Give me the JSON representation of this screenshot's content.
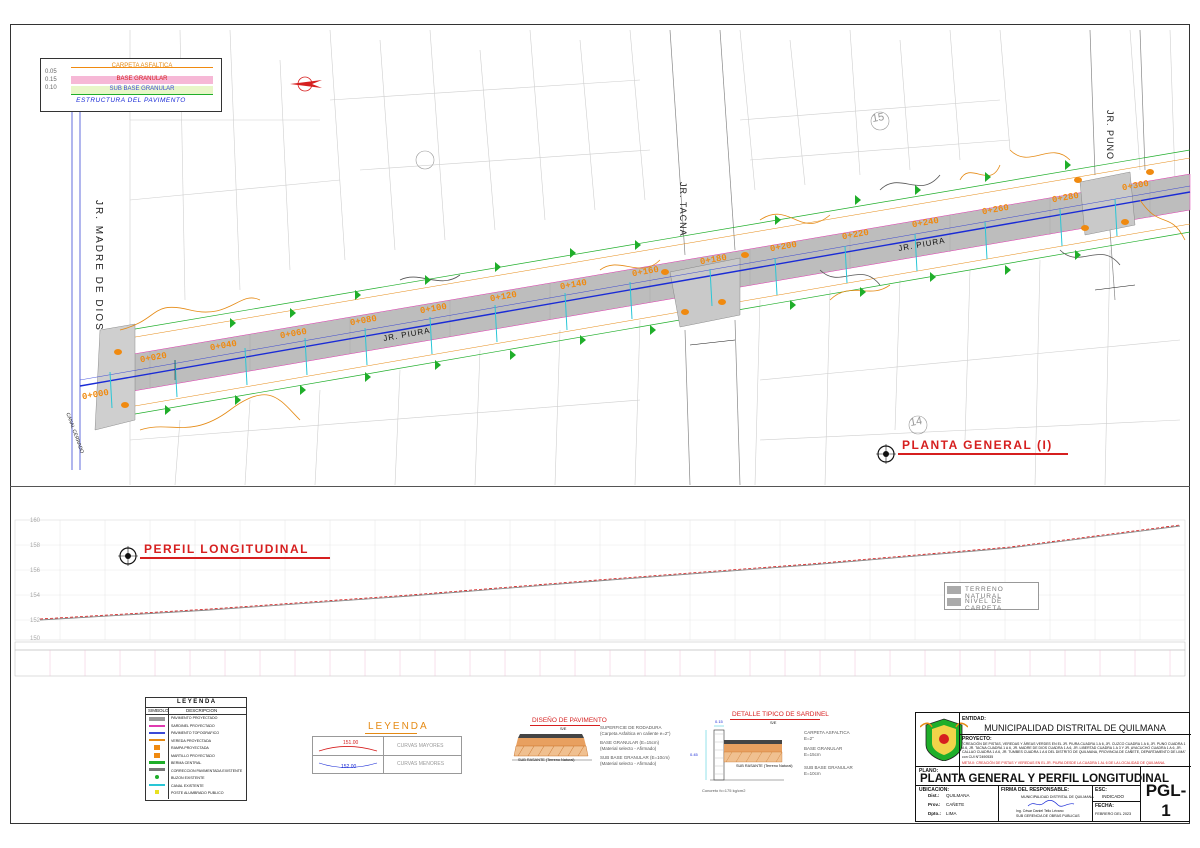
{
  "pavement_box": {
    "layers": [
      "CARPETA ASFALTICA",
      "BASE GRANULAR",
      "SUB BASE GRANULAR"
    ],
    "thicknesses": [
      "0.05",
      "0.15",
      "0.10"
    ],
    "caption": "ESTRUCTURA DEL PAVIMENTO"
  },
  "streets": {
    "madre": "JR. MADRE DE DIOS",
    "tacna": "JR. TACNA",
    "puno": "JR. PUNO",
    "piura_1": "JR. PIURA",
    "piura_2": "JR. PIURA",
    "piura_3": "JR. PIURA",
    "canal": "CANAL CERRADO"
  },
  "plan": {
    "stations": [
      "0+000",
      "0+020",
      "0+040",
      "0+060",
      "0+080",
      "0+100",
      "0+120",
      "0+140",
      "0+160",
      "0+180",
      "0+200",
      "0+220",
      "0+240",
      "0+260",
      "0+280",
      "0+300"
    ],
    "lot_labels": [
      "15",
      "14"
    ],
    "title": "PLANTA GENERAL (I)"
  },
  "profile": {
    "title": "PERFIL LONGITUDINAL",
    "legend": [
      "TERRENO NATURAL",
      "NIVEL DE CARPETA"
    ],
    "elev_labels": [
      "160",
      "158",
      "156",
      "154",
      "152",
      "150"
    ]
  },
  "legend_table": {
    "title": "L E Y E N D A",
    "col1": "SIMBOLO",
    "col2": "DESCRIPCION",
    "rows": [
      "PAVIMENTO PROYECTADO",
      "SARDINEL PROYECTADO",
      "PAVIMENTO TOPOGRAFICO",
      "VEREDA PROYECTADA",
      "RAMPA PROYECTADA",
      "MARTILLO PROYECTADO",
      "BERMA CENTRAL",
      "CORRECCION PAVIMENTADA EXISTENTE",
      "BUZON EXISTENTE",
      "CANAL EXISTENTE",
      "POSTE ALUMBRADO PUBLICO"
    ]
  },
  "leyenda_curves": {
    "title": "LEYENDA",
    "major": "CURVAS MAYORES",
    "minor": "CURVAS MENORES",
    "major_val": "151.00",
    "minor_val": "152.00"
  },
  "diseno": {
    "title": "DISEÑO DE PAVIMENTO",
    "scale": "S/E",
    "items": [
      "SUPERFICIE DE RODADURA",
      "(Carpeta Asfaltica en caliente e=2\")",
      "BASE GRANULAR (E=15cm)",
      "(Material selecto - Afirmado)",
      "SUB BASE GRANULAR (E=10cm)",
      "(Material selecto - Afirmado)"
    ],
    "ground": "SUB RASANTE (Terreno Natural)"
  },
  "sardinel": {
    "title": "DETALLE TIPICO DE SARDINEL",
    "scale": "S/E",
    "items": [
      "CARPETA ASFALTICA",
      "E=2\"",
      "BASE GRANULAR",
      "E=15cm",
      "SUB BASE GRANULAR",
      "E=10cm"
    ],
    "concrete": "Concreto fc=175 kg/cm2",
    "ground": "SUB RASANTE (Terreno Natural)",
    "dims": [
      "0.15",
      "0.45"
    ]
  },
  "title_block": {
    "entidad_lbl": "ENTIDAD:",
    "entidad": "MUNICIPALIDAD DISTRITAL DE QUILMANA",
    "proyecto_lbl": "PROYECTO:",
    "proyecto": "\"CREACIÓN DE PISTAS, VEREDAS Y ÁREAS VERDES EN EL JR. PIURA CUADRA 1 A 6, JR. CUZCO CUADRA 1 A 6, JR. PUNO CUADRA 1 A 6, JR. TACNA CUADRA 1 A 6, JR. MADRE DE DIOS CUADRA 1 A 6, JR. LIBERTAD CUADRA 1 A 3 Y JR. AYACUCHO CUADRA 1 A 6, JR. CALLAO CUADRA 1 A 6, JR. TUMBES CUADRA 1 A 6 DEL DISTRITO DE QUILMANA, PROVINCIA DE CAÑETE, DEPARTAMENTO DE LIMA\" con CUI N°2490535",
    "meta": "META II: CREACIÓN DE PISTAS Y VEREDAS EN EL JR. PIURA DESDE LA CUADRA 1 AL 6 DE LA LOCALIDAD DE QUILMANA.",
    "plano_lbl": "PLANO:",
    "plano": "PLANTA GENERAL Y PERFIL LONGITUDINAL",
    "code": "PGL-1",
    "ubicacion_lbl": "UBICACION:",
    "dist_lbl": "Dist.:",
    "dist": "QUILMANA",
    "prov_lbl": "Prov.:",
    "prov": "CAÑETE",
    "dpto_lbl": "Dpto.:",
    "dpto": "LIMA",
    "firma_lbl": "FIRMA DEL RESPONSABLE:",
    "firma_sub": "MUNICIPALIDAD DISTRITAL DE QUILMANA",
    "firma_name": "Ing. César Daniel Tello Lévano",
    "firma_role": "SUB GERENCIA DE OBRAS PUBLICAS",
    "esc_lbl": "ESC:",
    "esc": "INDICADO",
    "fecha_lbl": "FECHA:",
    "fecha": "FEBRERO DEL 2023"
  },
  "colors": {
    "road": "#b8b8b8",
    "axis": "#1a2bd6",
    "green": "#1fae2a",
    "orange": "#e58a14",
    "red": "#d61f1f",
    "cyan": "#29c6d6",
    "magenta": "#e03ab0"
  }
}
